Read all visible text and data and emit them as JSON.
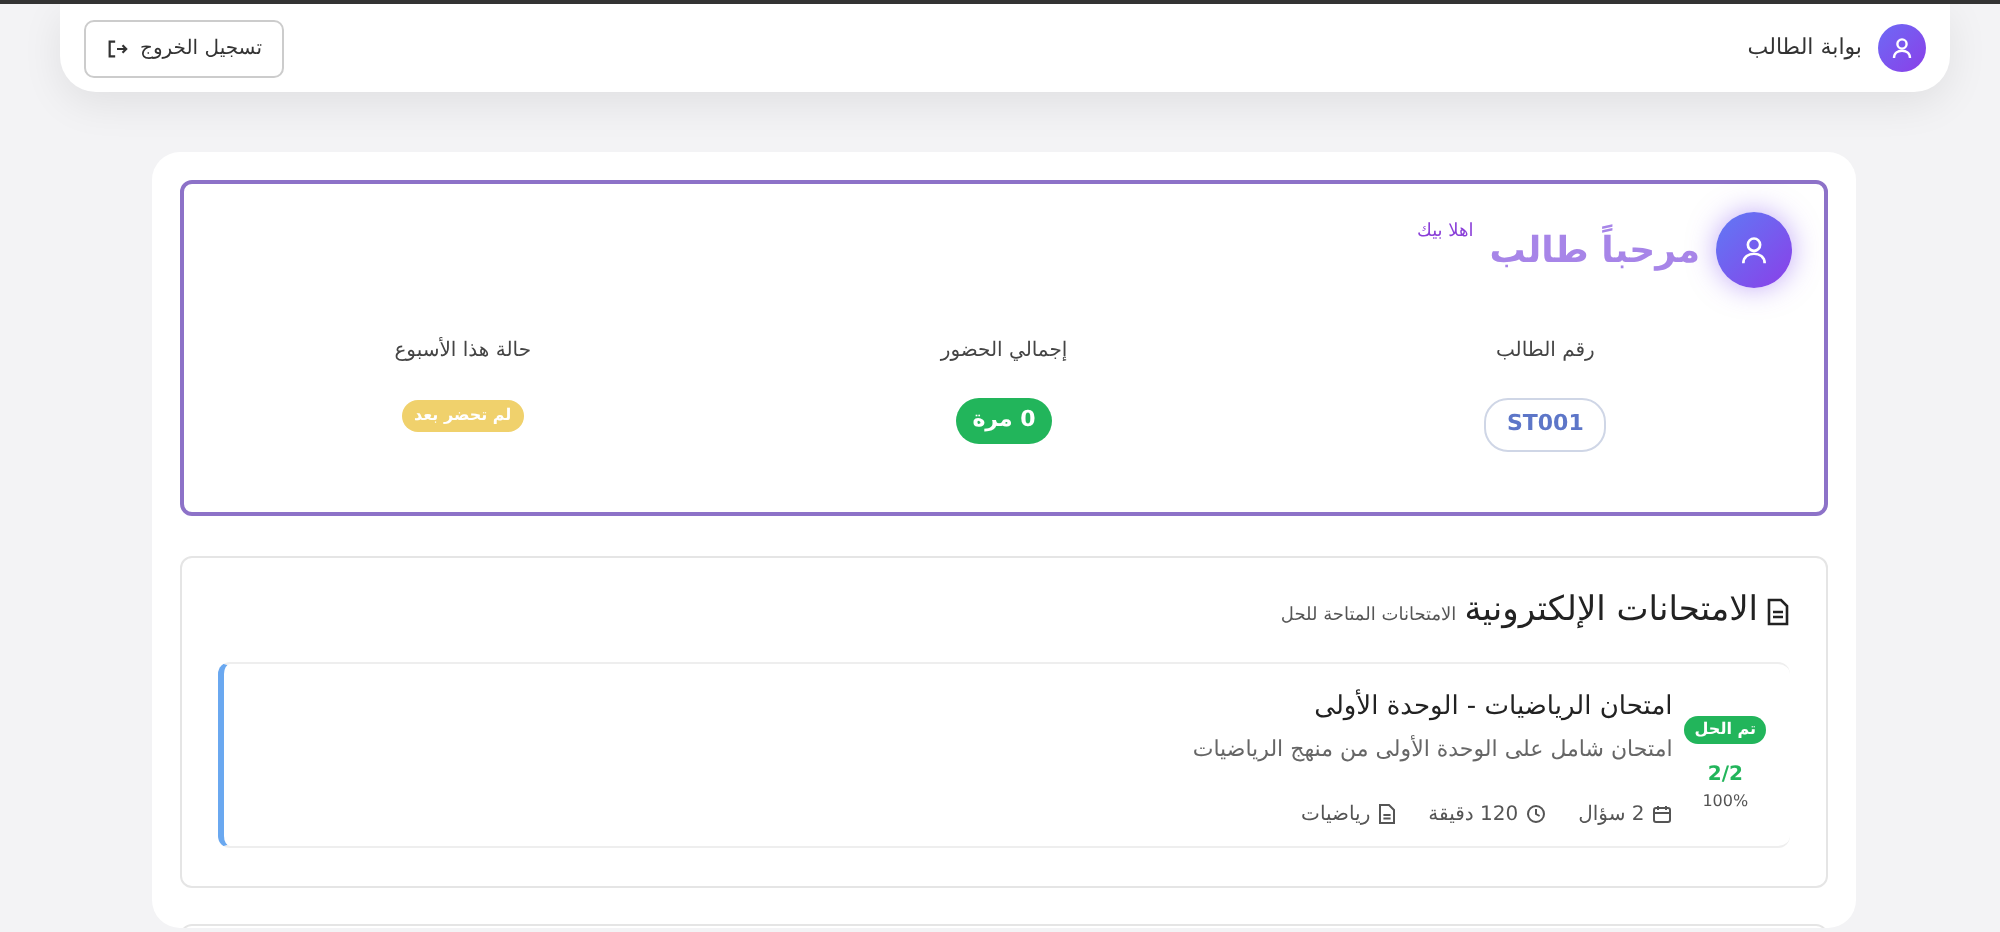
{
  "header": {
    "title": "بوابة الطالب",
    "logout_button": "تسجيل الخروج"
  },
  "welcome": {
    "greeting": "مرحباً طالب",
    "subtitle": "اهلا بيك",
    "stats": [
      {
        "label": "رقم الطالب",
        "value": "ST001",
        "kind": "outline"
      },
      {
        "label": "إجمالي الحضور",
        "value": "0 مرة",
        "kind": "success"
      },
      {
        "label": "حالة هذا الأسبوع",
        "value": "لم تحضر بعد",
        "kind": "warning"
      }
    ]
  },
  "exams": {
    "title": "الامتحانات الإلكترونية",
    "subtitle": "الامتحانات المتاحة للحل",
    "items": [
      {
        "title": "امتحان الرياضيات - الوحدة الأولى",
        "description": "امتحان شامل على الوحدة الأولى من منهج الرياضيات",
        "status": "تم الحل",
        "solved": true,
        "score": "2/2",
        "percent": "100%",
        "meta": [
          {
            "kind": "questions",
            "text": "2 سؤال"
          },
          {
            "kind": "duration",
            "text": "120 دقيقة"
          },
          {
            "kind": "subject",
            "text": "رياضيات"
          }
        ]
      }
    ]
  }
}
